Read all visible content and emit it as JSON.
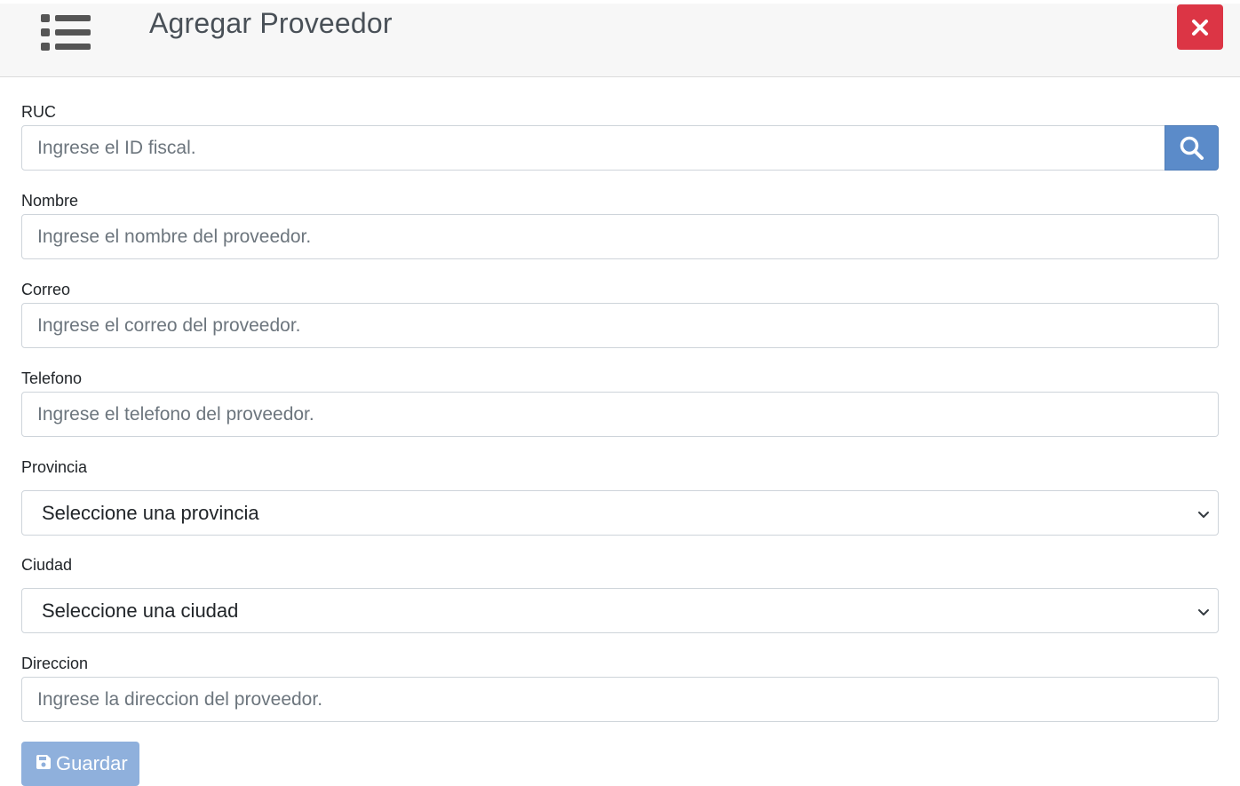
{
  "header": {
    "title": "Agregar Proveedor",
    "menu_icon": "list-icon",
    "close_icon": "close-icon",
    "close_color": "#dc3545"
  },
  "form": {
    "ruc": {
      "label": "RUC",
      "placeholder": "Ingrese el ID fiscal.",
      "search_icon": "search-icon"
    },
    "nombre": {
      "label": "Nombre",
      "placeholder": "Ingrese el nombre del proveedor."
    },
    "correo": {
      "label": "Correo",
      "placeholder": "Ingrese el correo del proveedor."
    },
    "telefono": {
      "label": "Telefono",
      "placeholder": "Ingrese el telefono del proveedor."
    },
    "provincia": {
      "label": "Provincia",
      "selected": "Seleccione una provincia"
    },
    "ciudad": {
      "label": "Ciudad",
      "selected": "Seleccione una ciudad"
    },
    "direccion": {
      "label": "Direccion",
      "placeholder": "Ingrese la direccion del proveedor."
    },
    "save": {
      "label": "Guardar",
      "icon": "save-icon",
      "color": "#8fb0dc"
    }
  },
  "colors": {
    "search_button": "#5b8bc9",
    "header_bg": "#f7f7f7"
  }
}
